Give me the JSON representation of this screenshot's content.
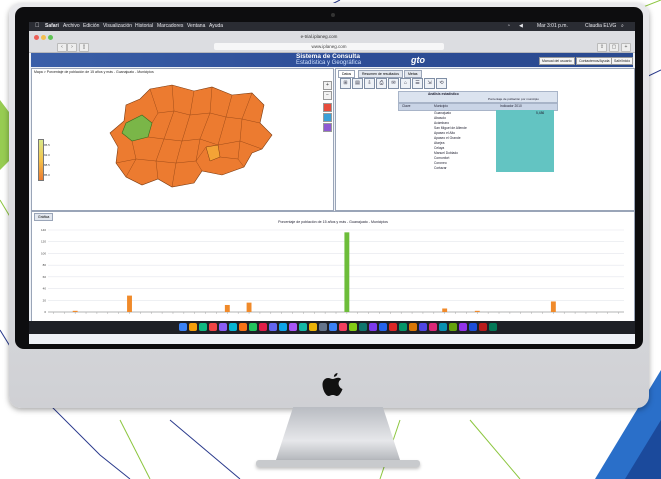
{
  "os_menubar": {
    "items": [
      "Safari",
      "Archivo",
      "Edición",
      "Visualización",
      "Historial",
      "Marcadores",
      "Ventana",
      "Ayuda"
    ],
    "clock": "Mar 3:01 p.m.",
    "user": "Claudia ELVG"
  },
  "browser": {
    "tab_title": "e-trial.iplaneg.com",
    "url": "www.iplaneg.com"
  },
  "app_header": {
    "title": "Sistema de Consulta",
    "subtitle": "Estadística y Geográfica",
    "logo": "gto",
    "buttons": [
      "Manual del usuario",
      "Contactenos/Ayuda",
      "Salir/Inicio"
    ]
  },
  "map_panel": {
    "title": "Mapa > Porcentaje de población de 15 años y más - Guanajuato - Municipios",
    "legend_labels": [
      "95.5",
      "92.0",
      "88.5",
      "85.0"
    ],
    "zoom_in": "+",
    "zoom_out": "−"
  },
  "right_panel": {
    "tabs": [
      "Datos",
      "Resumen de resultados",
      "Metas"
    ],
    "tools": [
      "⊞",
      "▤",
      "⇩",
      "⎙",
      "✉",
      "⌂",
      "☰",
      "⇲",
      "⟲"
    ],
    "table_title": "Análisis estadístico",
    "table_subtitle": "Porcentaje de población por municipio",
    "column_headers": [
      "Clave",
      "Municipio",
      "Indicador 2010"
    ],
    "rows": [
      {
        "name": "Guanajuato",
        "value": "5,486"
      },
      {
        "name": "Abasolo",
        "value": ""
      },
      {
        "name": "Acámbaro",
        "value": ""
      },
      {
        "name": "San Miguel de Allende",
        "value": ""
      },
      {
        "name": "Apaseo el Alto",
        "value": ""
      },
      {
        "name": "Apaseo el Grande",
        "value": ""
      },
      {
        "name": "Atarjea",
        "value": ""
      },
      {
        "name": "Celaya",
        "value": ""
      },
      {
        "name": "Manuel Doblado",
        "value": ""
      },
      {
        "name": "Comonfort",
        "value": ""
      },
      {
        "name": "Coroneo",
        "value": ""
      },
      {
        "name": "Cortazar",
        "value": ""
      }
    ]
  },
  "chart_panel": {
    "tab": "Gráfica",
    "title": "Porcentaje de población de 15 años y más - Guanajuato - Municipios"
  },
  "chart_data": {
    "type": "bar",
    "title": "Porcentaje de población de 15 años y más - Guanajuato - Municipios",
    "ylim": [
      0,
      140
    ],
    "yticks": [
      0,
      20,
      40,
      60,
      80,
      100,
      120,
      140
    ],
    "grid": true,
    "legend": "none",
    "values": [
      0,
      0,
      2,
      0,
      0,
      0,
      0,
      28,
      0,
      0,
      0,
      0,
      0,
      0,
      0,
      0,
      12,
      0,
      16,
      0,
      0,
      0,
      0,
      0,
      0,
      0,
      0,
      136,
      0,
      0,
      0,
      0,
      0,
      0,
      0,
      0,
      6,
      0,
      0,
      2,
      0,
      0,
      0,
      0,
      0,
      0,
      18,
      0,
      0,
      0,
      0,
      0,
      0
    ]
  },
  "colors": {
    "header": "#2c4c96",
    "map_high": "#ec7b30",
    "map_mid": "#f4a336",
    "map_low": "#7ab648",
    "bar_default": "#f08a2a",
    "bar_highlight": "#6dbd3a",
    "cell_fill": "#63c4c2"
  }
}
